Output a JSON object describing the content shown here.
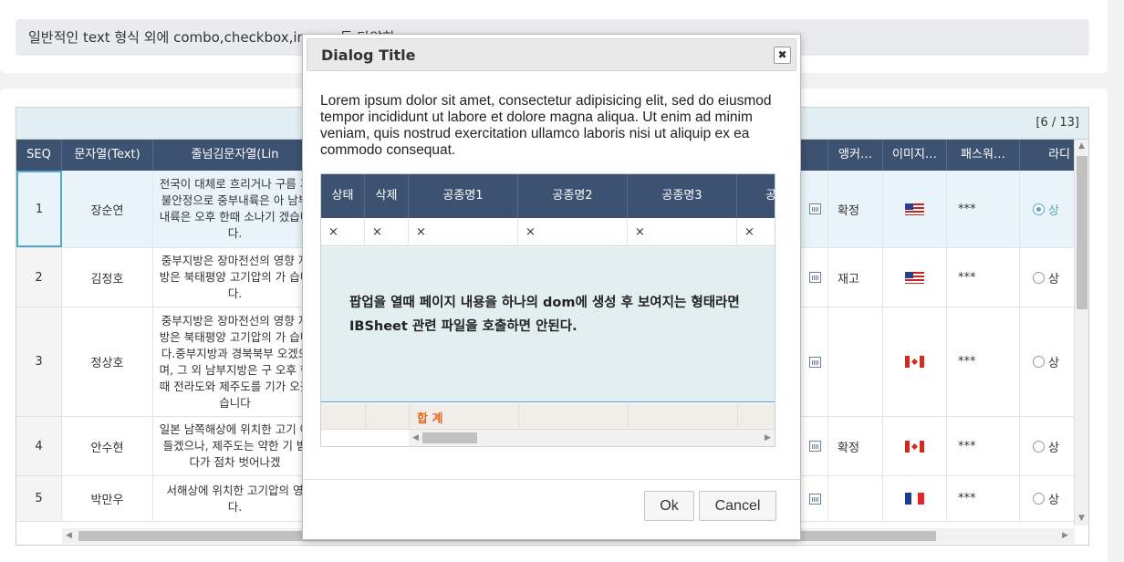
{
  "info": {
    "text": "일반적인 text 형식 외에 combo,checkbox,image 등 다양한 …          "
  },
  "grid": {
    "count": "[6 / 13]",
    "headers": {
      "seq": "SEQ",
      "text": "문자열(Text)",
      "lines": "줄넘김문자열(Lin",
      "anchor": "앵커…",
      "image": "이미지…",
      "password": "패스워…",
      "radio": "라디"
    },
    "rows": [
      {
        "seq": "1",
        "name": "장순연",
        "desc": "전국이 대체로 흐리거나 구름 기불안정으로 중부내륙은 아 남부내륙은 오후 한때 소나기 겠습니다.",
        "anchor": "확정",
        "flag": "us",
        "password": "***",
        "radio": "상"
      },
      {
        "seq": "2",
        "name": "김정호",
        "desc": "중부지방은 장마전선의 영향 지방은 북태평양 고기압의 가 습니다.",
        "anchor": "재고",
        "flag": "us",
        "password": "***",
        "radio": "상"
      },
      {
        "seq": "3",
        "name": "정상호",
        "desc": "중부지방은 장마전선의 영향 지방은 북태평양 고기압의 가 습니다.중부지방과 경북북부 오겠으며, 그 외 남부지방은 구 오후 한때 전라도와 제주도를 기가 오겠습니다",
        "anchor": "",
        "flag": "ca",
        "password": "***",
        "radio": "상"
      },
      {
        "seq": "4",
        "name": "안수현",
        "desc": "일본 남쪽해상에 위치한 고기 에 들겠으나, 제주도는 약한 기 받다가 점차 벗어나겠",
        "anchor": "확정",
        "flag": "ca",
        "password": "***",
        "radio": "상"
      },
      {
        "seq": "5",
        "name": "박만우",
        "desc": "서해상에 위치한 고기압의 영 다.",
        "anchor": "",
        "flag": "fr",
        "password": "***",
        "radio": "상"
      }
    ]
  },
  "dialog": {
    "title": "Dialog Title",
    "close": "✖",
    "body": "Lorem ipsum dolor sit amet, consectetur adipisicing elit, sed do eiusmod tempor incididunt ut labore et dolore magna aliqua. Ut enim ad minim veniam, quis nostrud exercitation ullamco laboris nisi ut aliquip ex ea commodo consequat.",
    "inner_grid": {
      "headers": [
        "상태",
        "삭제",
        "공종명1",
        "공종명2",
        "공종명3",
        "공"
      ],
      "filter_row": [
        "×",
        "×",
        "×",
        "×",
        "×",
        "×"
      ],
      "empty_message": "팝업을 열때 페이지 내용을 하나의 dom에 생성 후 보여지는 형태라면 IBSheet 관련 파일을 호출하면 안된다.",
      "sum_label": "합 계"
    },
    "ok": "Ok",
    "cancel": "Cancel"
  }
}
